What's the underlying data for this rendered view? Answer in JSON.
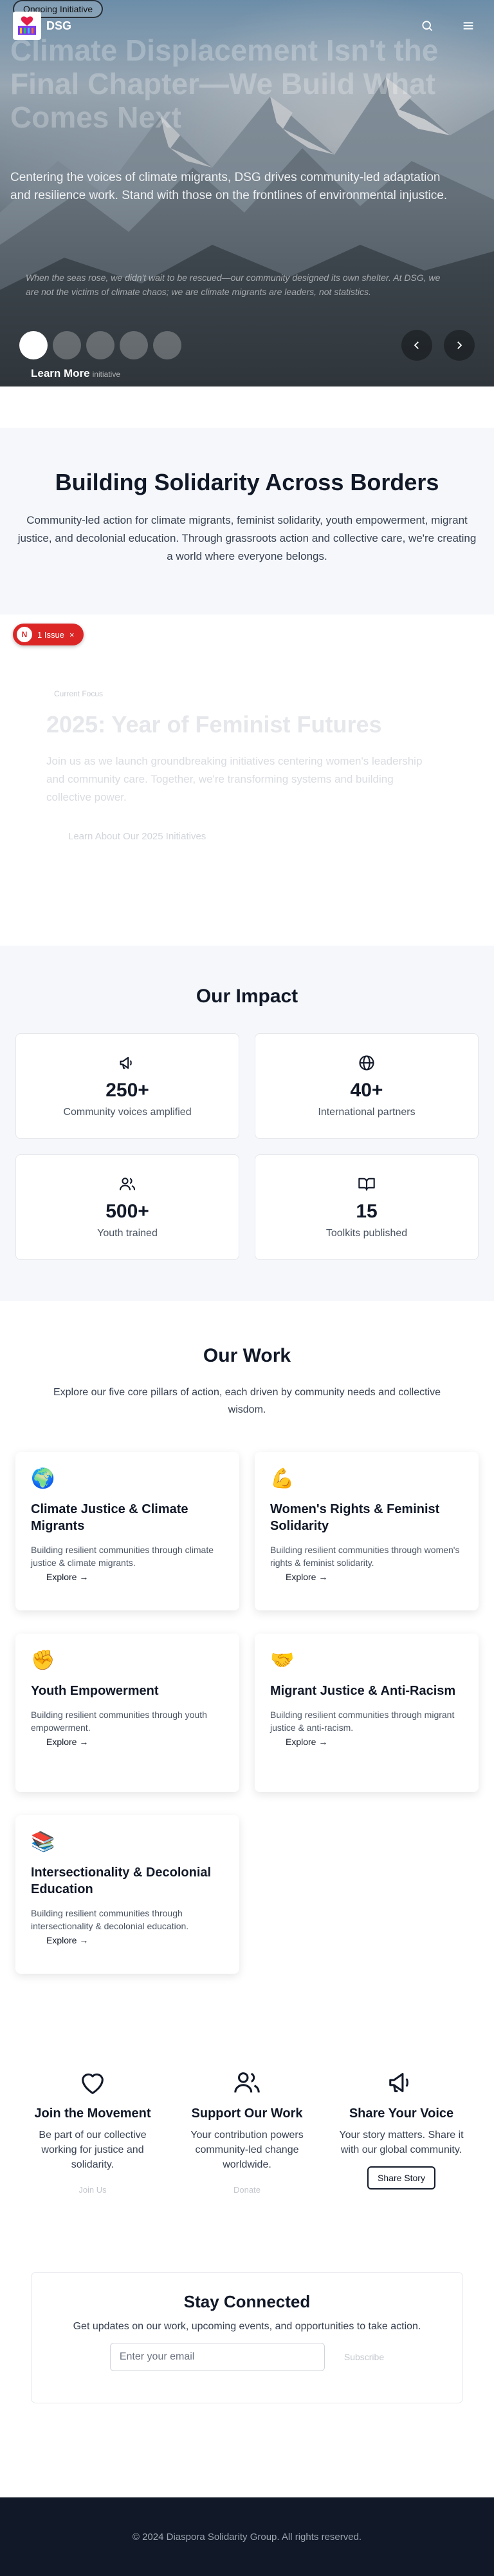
{
  "header": {
    "logo_text": "DSG",
    "badge": "Ongoing Initiative"
  },
  "hero": {
    "title": "Climate Displacement Isn't the Final Chapter—We Build What Comes Next",
    "subtitle": "Centering the voices of climate migrants, DSG drives community-led adaptation and resilience work. Stand with those on the frontlines of environmental injustice.",
    "quote": "When the seas rose, we didn't wait to be rescued—our community designed its own shelter. At DSG, we are not the victims of climate chaos; we are climate migrants are leaders, not statistics.",
    "learn_more": "Learn More",
    "learn_more_suffix": "initiative"
  },
  "solidarity": {
    "title": "Building Solidarity Across Borders",
    "body": "Community-led action for climate migrants, feminist solidarity, youth empowerment, migrant justice, and decolonial education. Through grassroots action and collective care, we're creating a world where everyone belongs."
  },
  "issue_pill": {
    "badge": "N",
    "label": "1 Issue",
    "close": "×"
  },
  "featured": {
    "tag": "Current Focus",
    "title": "2025: Year of Feminist Futures",
    "body": "Join us as we launch groundbreaking initiatives centering women's leadership and community care. Together, we're transforming systems and building collective power.",
    "link": "Learn About Our 2025 Initiatives"
  },
  "impact": {
    "title": "Our Impact",
    "stats": [
      {
        "value": "250+",
        "label": "Community voices amplified",
        "icon": "megaphone-icon"
      },
      {
        "value": "40+",
        "label": "International partners",
        "icon": "globe-icon"
      },
      {
        "value": "500+",
        "label": "Youth trained",
        "icon": "users-icon"
      },
      {
        "value": "15",
        "label": "Toolkits published",
        "icon": "book-icon"
      }
    ]
  },
  "work": {
    "title": "Our Work",
    "intro": "Explore our five core pillars of action, each driven by community needs and collective wisdom.",
    "explore_label": "Explore →",
    "cards": [
      {
        "emoji": "🌍",
        "title": "Climate Justice & Climate Migrants",
        "body": "Building resilient communities through climate justice & climate migrants."
      },
      {
        "emoji": "💪",
        "title": "Women's Rights & Feminist Solidarity",
        "body": "Building resilient communities through women's rights & feminist solidarity."
      },
      {
        "emoji": "✊",
        "title": "Youth Empowerment",
        "body": "Building resilient communities through youth empowerment."
      },
      {
        "emoji": "🤝",
        "title": "Migrant Justice & Anti-Racism",
        "body": "Building resilient communities through migrant justice & anti-racism."
      },
      {
        "emoji": "📚",
        "title": "Intersectionality & Decolonial Education",
        "body": "Building resilient communities through intersectionality & decolonial education."
      }
    ]
  },
  "actions": [
    {
      "icon": "heart-icon",
      "title": "Join the Movement",
      "body": "Be part of our collective working for justice and solidarity.",
      "cta": "Join Us"
    },
    {
      "icon": "users-icon",
      "title": "Support Our Work",
      "body": "Your contribution powers community-led change worldwide.",
      "cta": "Donate"
    },
    {
      "icon": "megaphone-icon",
      "title": "Share Your Voice",
      "body": "Your story matters. Share it with our global community.",
      "cta": "Share Story"
    }
  ],
  "newsletter": {
    "title": "Stay Connected",
    "body": "Get updates on our work, upcoming events, and opportunities to take action.",
    "placeholder": "Enter your email",
    "button": "Subscribe"
  },
  "footer": {
    "copyright": "© 2024 Diaspora Solidarity Group. All rights reserved."
  }
}
